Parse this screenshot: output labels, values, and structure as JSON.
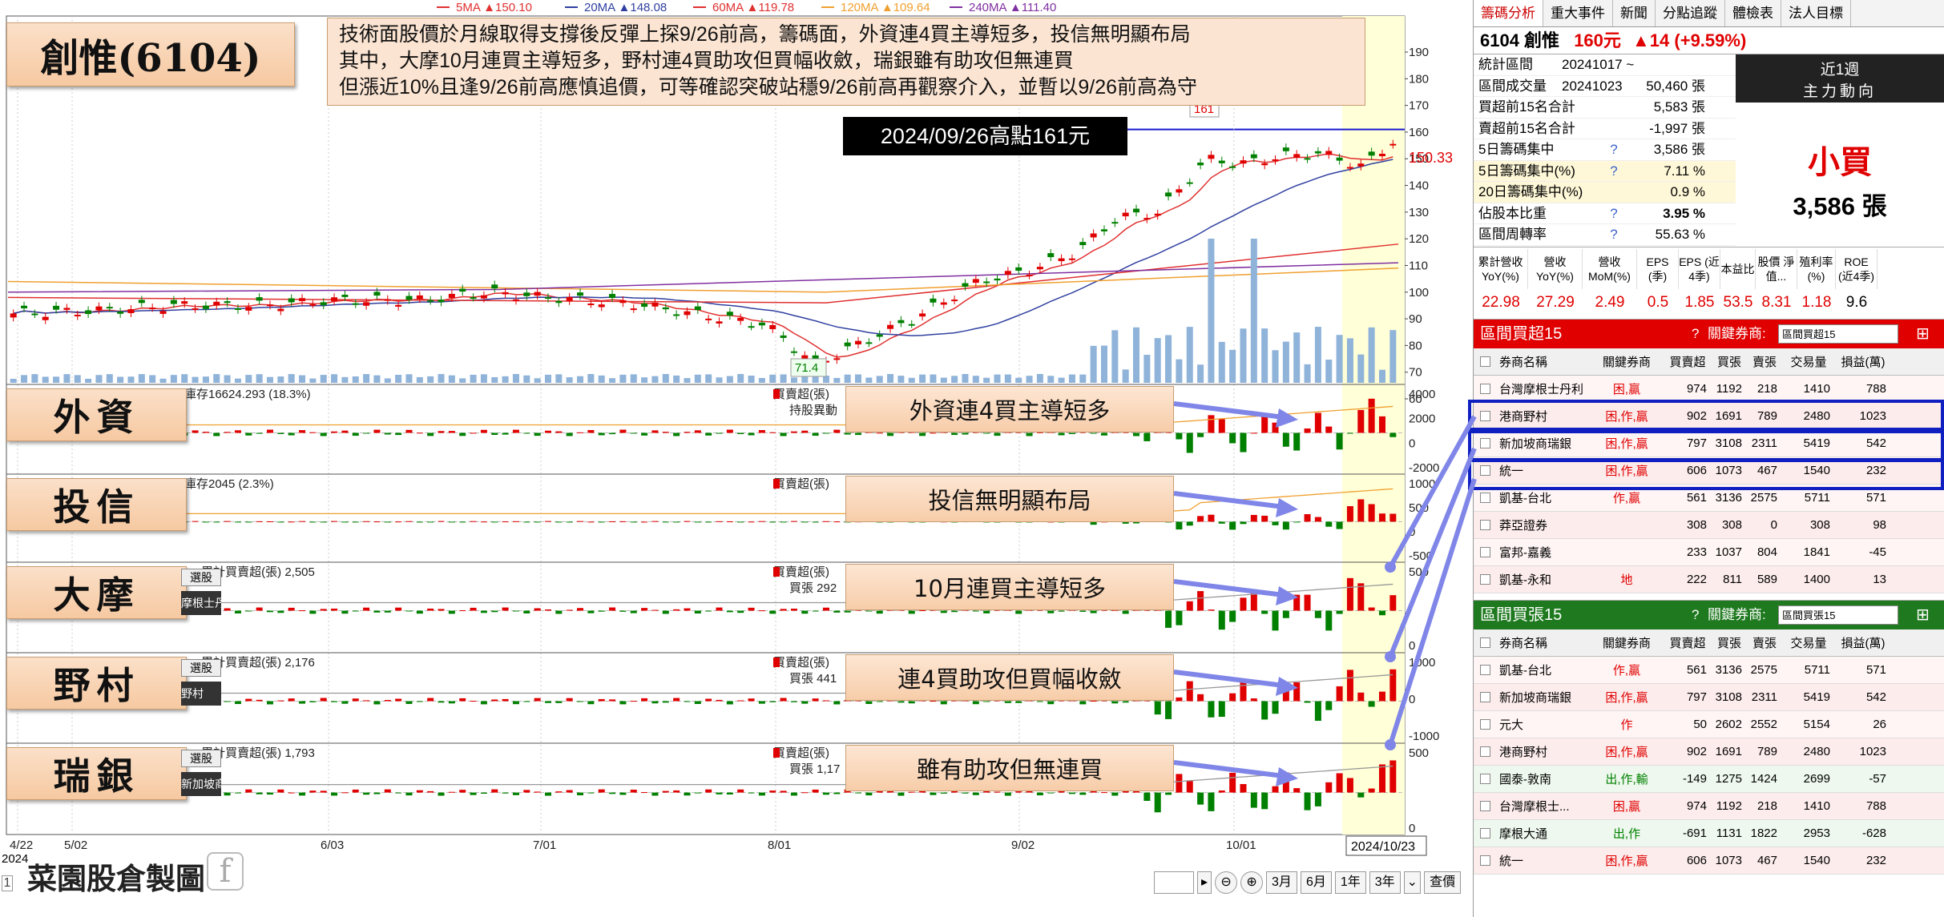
{
  "stock": {
    "title": "創惟(6104)",
    "watermark": "菜園股倉製圖"
  },
  "note": {
    "lines": [
      "技術面股價於月線取得支撐後反彈上探9/26前高，籌碼面，外資連4買主導短多，投信無明顯布局",
      "其中，大摩10月連買主導短多，野村連4買助攻但買幅收斂，瑞銀雖有助攻但無連買",
      "但漲近10%且逢9/26前高應慎追價，可等確認突破站穩9/26前高再觀察介入，並暫以9/26前高為守"
    ]
  },
  "high_label": "2024/09/26高點161元",
  "ma_legend": [
    {
      "label": "5MA ▲150.10",
      "color": "#e03030"
    },
    {
      "label": "20MA ▲148.08",
      "color": "#3040a0"
    },
    {
      "label": "60MA ▲119.78",
      "color": "#e03030"
    },
    {
      "label": "120MA ▲109.64",
      "color": "#f0a030"
    },
    {
      "label": "240MA ▲111.40",
      "color": "#8030a0"
    }
  ],
  "price_axis": [
    "190",
    "180",
    "170",
    "160",
    "150",
    "140",
    "130",
    "120",
    "110",
    "100",
    "90",
    "80",
    "70",
    "60"
  ],
  "last_price": "150.33",
  "peak_tag": "161",
  "low_tag": "71.4",
  "date_axis": [
    "4/22",
    "5/02",
    "6/03",
    "7/01",
    "8/01",
    "9/02",
    "10/01"
  ],
  "year_label": "2024",
  "current_date": "2024/10/23",
  "sections": [
    {
      "label": "外資",
      "annot": "外資連4買主導短多",
      "info": "庫存16624.293 (18.3%)",
      "legend1": "買賣超(張)",
      "legend2": "持股異動",
      "axis": [
        "4000",
        "2000",
        "0",
        "-2000"
      ]
    },
    {
      "label": "投信",
      "annot": "投信無明顯布局",
      "info": "庫存2045 (2.3%)",
      "legend1": "買賣超(張)",
      "legend2": "",
      "axis": [
        "1000",
        "500",
        "0",
        "-500"
      ]
    },
    {
      "label": "大摩",
      "annot": "10月連買主導短多",
      "info": "一 累計買賣超(張) 2,505",
      "legend1": "買賣超(張)",
      "legend2": "買張 292",
      "axis": [
        "500",
        "0"
      ],
      "tag1": "選股",
      "tag2": "摩根士丹"
    },
    {
      "label": "野村",
      "annot": "連4買助攻但買幅收斂",
      "info": "一 累計買賣超(張) 2,176",
      "legend1": "買賣超(張)",
      "legend2": "買張 441",
      "axis": [
        "1000",
        "0",
        "-1000"
      ],
      "tag1": "選股",
      "tag2": "野村"
    },
    {
      "label": "瑞銀",
      "annot": "雖有助攻但無連買",
      "info": "一 累計買賣超(張) 1,793",
      "legend1": "買賣超(張)",
      "legend2": "買張 1,17",
      "axis": [
        "500",
        "0"
      ],
      "tag1": "選股",
      "tag2": "新加坡商瑞"
    }
  ],
  "toolbar": {
    "ranges": [
      "3月",
      "6月",
      "1年",
      "3年"
    ],
    "query": "查價",
    "small": "1"
  },
  "right": {
    "tabs": [
      "籌碼分析",
      "重大事件",
      "新聞",
      "分點追蹤",
      "體檢表",
      "法人目標"
    ],
    "header": {
      "code": "6104 創惟",
      "price": "160元",
      "change": "▲14 (+9.59%)"
    },
    "stats": [
      {
        "k": "統計區間",
        "v": "20241017 ~ 20241023",
        "q": ""
      },
      {
        "k": "區間成交量",
        "v": "50,460 張",
        "q": ""
      },
      {
        "k": "買超前15名合計",
        "v": "5,583 張",
        "q": ""
      },
      {
        "k": "賣超前15名合計",
        "v": "-1,997 張",
        "q": ""
      },
      {
        "k": "5日籌碼集中",
        "v": "3,586 張",
        "q": "?"
      },
      {
        "k": "5日籌碼集中(%)",
        "v": "7.11 %",
        "q": "?"
      },
      {
        "k": "20日籌碼集中(%)",
        "v": "0.9 %",
        "q": ""
      },
      {
        "k": "佔股本比重",
        "v": "3.95 %",
        "q": "?"
      },
      {
        "k": "區間周轉率",
        "v": "55.63 %",
        "q": "?"
      }
    ],
    "main_force": {
      "title1": "近1週",
      "title2": "主力動向",
      "result": "小買",
      "amount": "3,586 張"
    },
    "fund": {
      "heads": [
        "累計營收 YoY(%)",
        "營收 YoY(%)",
        "營收 MoM(%)",
        "EPS (季)",
        "EPS (近4季)",
        "本益比",
        "股價 淨值...",
        "殖利率 (%)",
        "ROE (近4季)"
      ],
      "values": [
        "22.98",
        "27.29",
        "2.49",
        "0.5",
        "1.85",
        "53.5",
        "8.31",
        "1.18",
        "9.6"
      ]
    },
    "buy": {
      "title": "區間買超15",
      "q": "?",
      "key_label": "關鍵券商:",
      "select": "區間買超15",
      "cols": [
        "券商名稱",
        "關鍵券商",
        "買賣超",
        "買張",
        "賣張",
        "交易量",
        "損益(萬)"
      ],
      "rows": [
        [
          "台灣摩根士丹利",
          "困,贏",
          "974",
          "1192",
          "218",
          "1410",
          "788"
        ],
        [
          "港商野村",
          "困,作,贏",
          "902",
          "1691",
          "789",
          "2480",
          "1023"
        ],
        [
          "新加坡商瑞銀",
          "困,作,贏",
          "797",
          "3108",
          "2311",
          "5419",
          "542"
        ],
        [
          "統一",
          "困,作,贏",
          "606",
          "1073",
          "467",
          "1540",
          "232"
        ],
        [
          "凱基-台北",
          "作,贏",
          "561",
          "3136",
          "2575",
          "5711",
          "571"
        ],
        [
          "莽亞證券",
          "",
          "308",
          "308",
          "0",
          "308",
          "98"
        ],
        [
          "富邦-嘉義",
          "",
          "233",
          "1037",
          "804",
          "1841",
          "-45"
        ],
        [
          "凱基-永和",
          "地",
          "222",
          "811",
          "589",
          "1400",
          "13"
        ]
      ]
    },
    "sell": {
      "title": "區間買張15",
      "q": "?",
      "key_label": "關鍵券商:",
      "select": "區間買張15",
      "cols": [
        "券商名稱",
        "關鍵券商",
        "買賣超",
        "買張",
        "賣張",
        "交易量",
        "損益(萬)"
      ],
      "rows": [
        [
          "凱基-台北",
          "作,贏",
          "561",
          "3136",
          "2575",
          "5711",
          "571"
        ],
        [
          "新加坡商瑞銀",
          "困,作,贏",
          "797",
          "3108",
          "2311",
          "5419",
          "542"
        ],
        [
          "元大",
          "作",
          "50",
          "2602",
          "2552",
          "5154",
          "26"
        ],
        [
          "港商野村",
          "困,作,贏",
          "902",
          "1691",
          "789",
          "2480",
          "1023"
        ],
        [
          "國泰-敦南",
          "出,作,輸",
          "-149",
          "1275",
          "1424",
          "2699",
          "-57"
        ],
        [
          "台灣摩根士...",
          "困,贏",
          "974",
          "1192",
          "218",
          "1410",
          "788"
        ],
        [
          "摩根大通",
          "出,作",
          "-691",
          "1131",
          "1822",
          "2953",
          "-628"
        ],
        [
          "統一",
          "困,作,贏",
          "606",
          "1073",
          "467",
          "1540",
          "232"
        ]
      ]
    },
    "colors": {
      "red": "#e00000",
      "green": "#008000",
      "blue": "#0000cc"
    }
  }
}
